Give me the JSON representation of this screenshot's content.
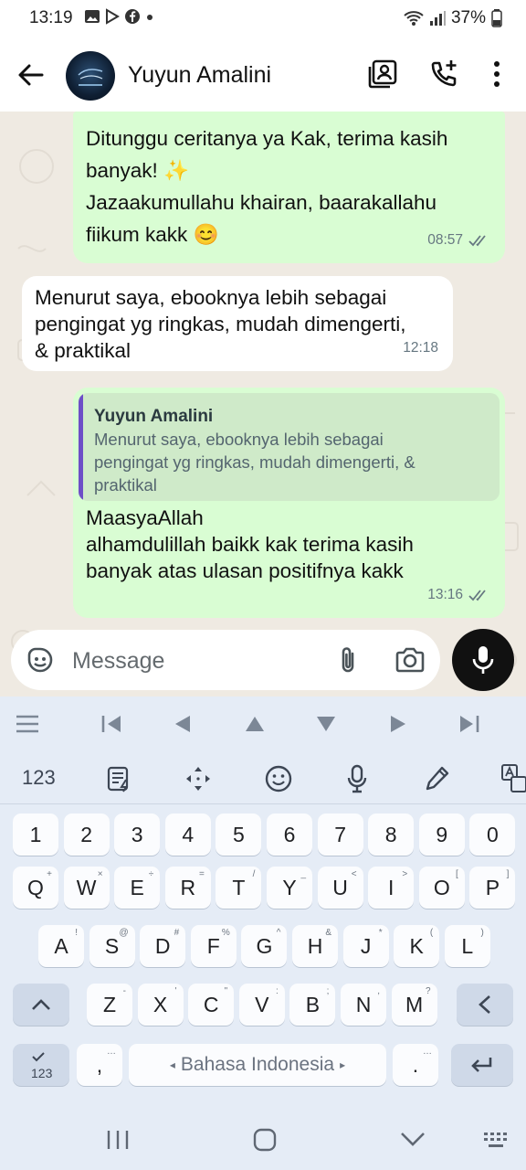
{
  "status_bar": {
    "time": "13:19",
    "battery": "37%"
  },
  "header": {
    "contact_name": "Yuyun Amalini"
  },
  "messages": [
    {
      "dir": "out",
      "lines": [
        "Ditunggu ceritanya ya Kak, terima kasih",
        "banyak! ✨",
        "Jazaakumullahu khairan, baarakallahu",
        "fiikum kakk 😊"
      ],
      "time": "08:57"
    },
    {
      "dir": "in",
      "lines": [
        "Menurut saya, ebooknya lebih sebagai",
        "pengingat yg ringkas, mudah dimengerti,",
        "& praktikal"
      ],
      "time": "12:18"
    },
    {
      "dir": "out",
      "quote_author": "Yuyun Amalini",
      "quote_lines": [
        "Menurut saya, ebooknya lebih sebagai",
        "pengingat yg ringkas, mudah dimengerti, &",
        "praktikal"
      ],
      "lines": [
        "MaasyaAllah",
        "alhamdulillah baikk kak terima kasih",
        "banyak atas ulasan positifnya kakk"
      ],
      "time": "13:16"
    }
  ],
  "composer": {
    "placeholder": "Message"
  },
  "keyboard": {
    "toolbar_label": "123",
    "row_numbers": [
      "1",
      "2",
      "3",
      "4",
      "5",
      "6",
      "7",
      "8",
      "9",
      "0"
    ],
    "row_q": [
      [
        "Q",
        "+"
      ],
      [
        "W",
        "×"
      ],
      [
        "E",
        "÷"
      ],
      [
        "R",
        "="
      ],
      [
        "T",
        "/"
      ],
      [
        "Y",
        "_"
      ],
      [
        "U",
        "<"
      ],
      [
        "I",
        ">"
      ],
      [
        "O",
        "["
      ],
      [
        "P",
        "]"
      ]
    ],
    "row_a": [
      [
        "A",
        "!"
      ],
      [
        "S",
        "@"
      ],
      [
        "D",
        "#"
      ],
      [
        "F",
        "%"
      ],
      [
        "G",
        "^"
      ],
      [
        "H",
        "&"
      ],
      [
        "J",
        "*"
      ],
      [
        "K",
        "("
      ],
      [
        "L",
        ")"
      ]
    ],
    "row_z": [
      [
        "Z",
        "-"
      ],
      [
        "X",
        "'"
      ],
      [
        "C",
        "\""
      ],
      [
        "V",
        ":"
      ],
      [
        "B",
        ";"
      ],
      [
        "N",
        ","
      ],
      [
        "M",
        "?"
      ]
    ],
    "sym_key_label": "123",
    "comma": ",",
    "space_label": "Bahasa Indonesia",
    "period": ".",
    "dots": "…"
  },
  "colors": {
    "outgoing_bubble": "#d9fdd3",
    "chat_bg": "#efeae2",
    "keyboard_bg": "#e5ecf6",
    "quote_bar": "#6d4fc7",
    "read_ticks": "#667781"
  }
}
